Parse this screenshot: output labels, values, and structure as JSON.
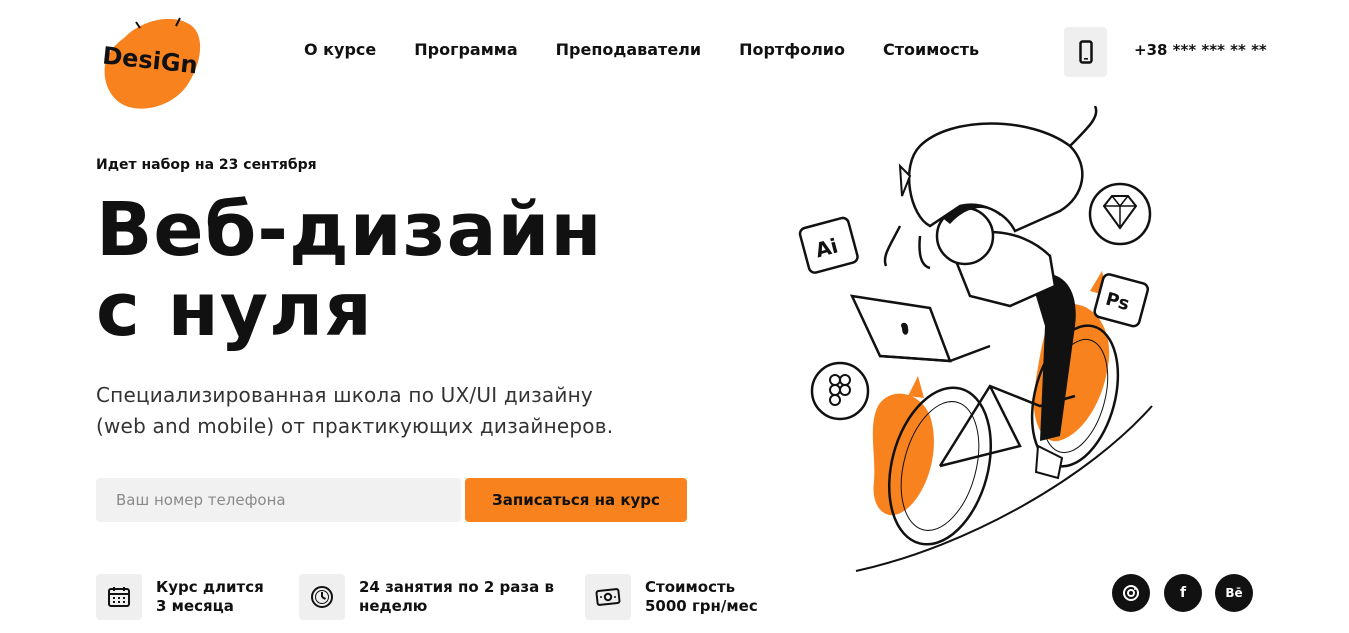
{
  "logo": {
    "text": "DesiGn"
  },
  "nav": {
    "items": [
      {
        "label": "О курсе"
      },
      {
        "label": "Программа"
      },
      {
        "label": "Преподаватели"
      },
      {
        "label": "Портфолио"
      },
      {
        "label": "Стоимость"
      }
    ]
  },
  "contact": {
    "phone": "+38 *** *** ** **",
    "phone_icon": "mobile-phone-icon"
  },
  "hero": {
    "enrollment": "Идет набор на 23 сентября",
    "title_line1": "Веб-дизайн",
    "title_line2": "с нуля",
    "subtitle_line1": "Специализированная школа по UX/UI дизайну",
    "subtitle_line2": "(web and mobile) от практикующих дизайнеров."
  },
  "form": {
    "phone_placeholder": "Ваш номер телефона",
    "phone_value": "",
    "submit_label": "Записаться на курс"
  },
  "features": [
    {
      "icon": "calendar-icon",
      "line1": "Курс длится",
      "line2": "3 месяца"
    },
    {
      "icon": "clock-icon",
      "line1": "24 занятия по 2 раза в",
      "line2": "неделю"
    },
    {
      "icon": "money-icon",
      "line1": "Стоимость",
      "line2": "5000 грн/мес"
    }
  ],
  "social": [
    {
      "icon": "instagram-icon"
    },
    {
      "icon": "facebook-icon",
      "glyph": "f"
    },
    {
      "icon": "behance-icon",
      "glyph": "Bē"
    }
  ],
  "illustration": {
    "badges": [
      "Ai",
      "Ps"
    ]
  },
  "colors": {
    "accent": "#f7821e",
    "dark": "#111111",
    "chip": "#efefef"
  }
}
